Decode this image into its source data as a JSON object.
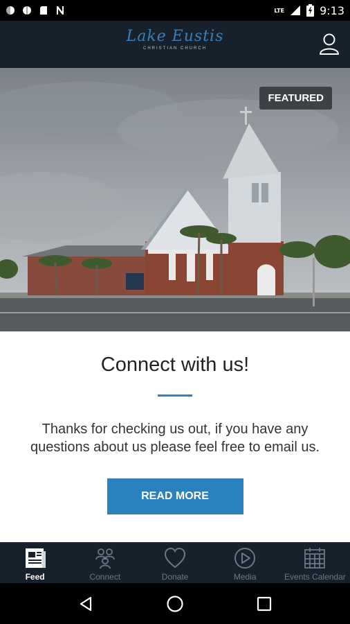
{
  "status_bar": {
    "time": "9:13",
    "network": "LTE",
    "icons": [
      "notification-icon",
      "notification-icon",
      "sd-card-icon",
      "n-icon"
    ]
  },
  "app_bar": {
    "logo_text": "Lake Eustis",
    "logo_subtext": "CHRISTIAN CHURCH",
    "profile_icon": "user-icon"
  },
  "hero": {
    "badge": "FEATURED"
  },
  "card": {
    "title": "Connect with us!",
    "body": "Thanks for checking us out, if you have any questions about us please feel free to email us.",
    "button_label": "READ MORE"
  },
  "bottom_nav": {
    "items": [
      {
        "label": "Feed",
        "icon": "feed-icon",
        "active": true
      },
      {
        "label": "Connect",
        "icon": "people-icon",
        "active": false
      },
      {
        "label": "Donate",
        "icon": "heart-icon",
        "active": false
      },
      {
        "label": "Media",
        "icon": "play-icon",
        "active": false
      },
      {
        "label": "Events Calendar",
        "icon": "calendar-icon",
        "active": false
      }
    ]
  },
  "colors": {
    "app_bar": "#16212c",
    "accent": "#2b81bd",
    "badge_bg": "#3c4246"
  }
}
